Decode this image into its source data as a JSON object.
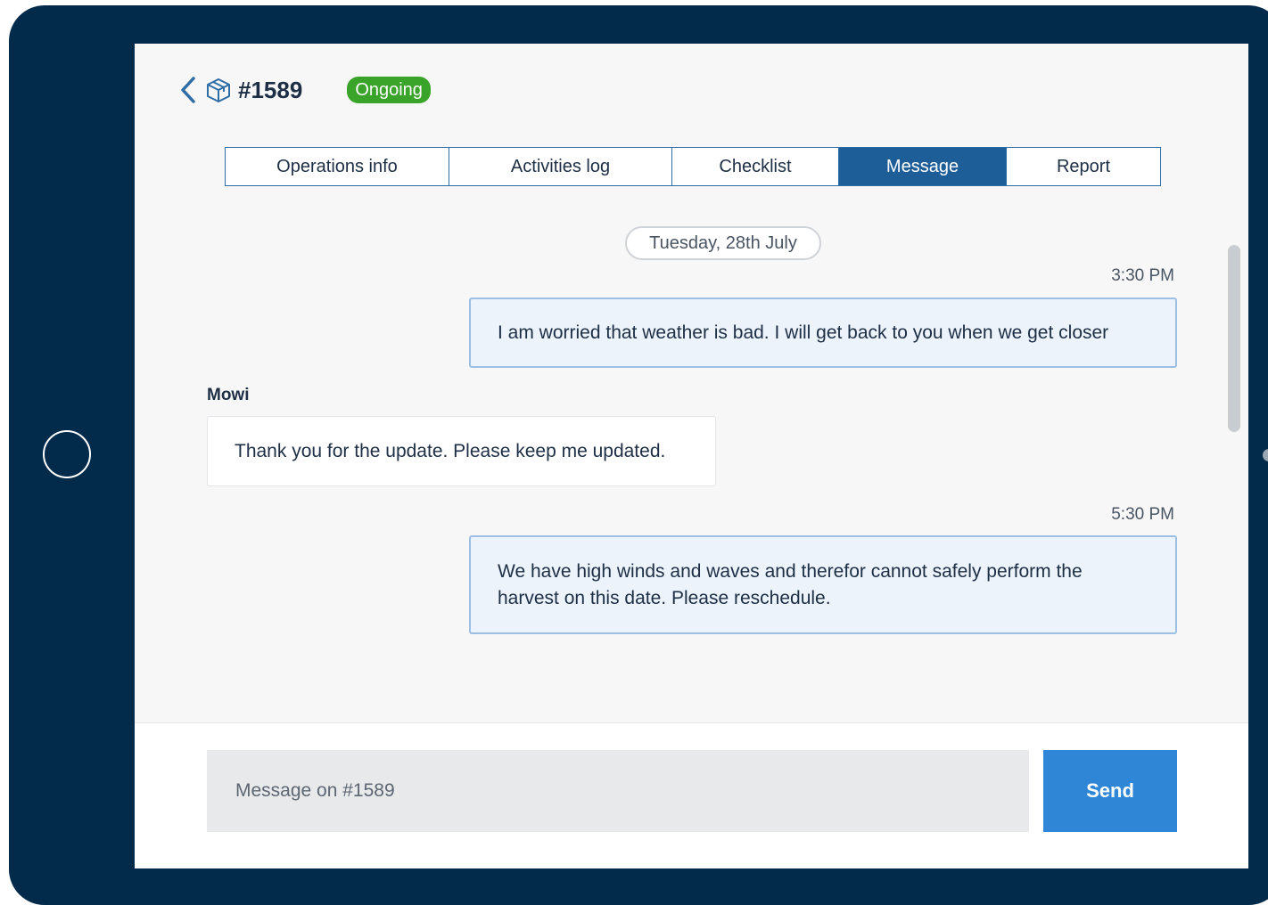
{
  "header": {
    "ticket_id": "#1589",
    "status": "Ongoing",
    "status_color": "#3aa329",
    "back_icon": "chevron-left-icon",
    "item_icon": "package-icon"
  },
  "tabs": [
    {
      "label": "Operations info",
      "active": false
    },
    {
      "label": "Activities log",
      "active": false
    },
    {
      "label": "Checklist",
      "active": false
    },
    {
      "label": "Message",
      "active": true
    },
    {
      "label": "Report",
      "active": false
    }
  ],
  "conversation": {
    "date": "Tuesday, 28th July",
    "messages": [
      {
        "direction": "outgoing",
        "time": "3:30 PM",
        "text": "I am worried that weather is bad. I will get back to you when we get closer"
      },
      {
        "direction": "incoming",
        "sender": "Mowi",
        "text": "Thank you for the update. Please keep me updated."
      },
      {
        "direction": "outgoing",
        "time": "5:30 PM",
        "text": "We have high winds and waves and therefor cannot safely perform the harvest on this date. Please reschedule."
      }
    ]
  },
  "composer": {
    "placeholder": "Message on #1589",
    "value": "",
    "send_label": "Send"
  },
  "colors": {
    "frame": "#022a4b",
    "accent": "#1e5e98",
    "send_button": "#2f86d6",
    "outgoing_bubble": "#ecf3fb"
  }
}
